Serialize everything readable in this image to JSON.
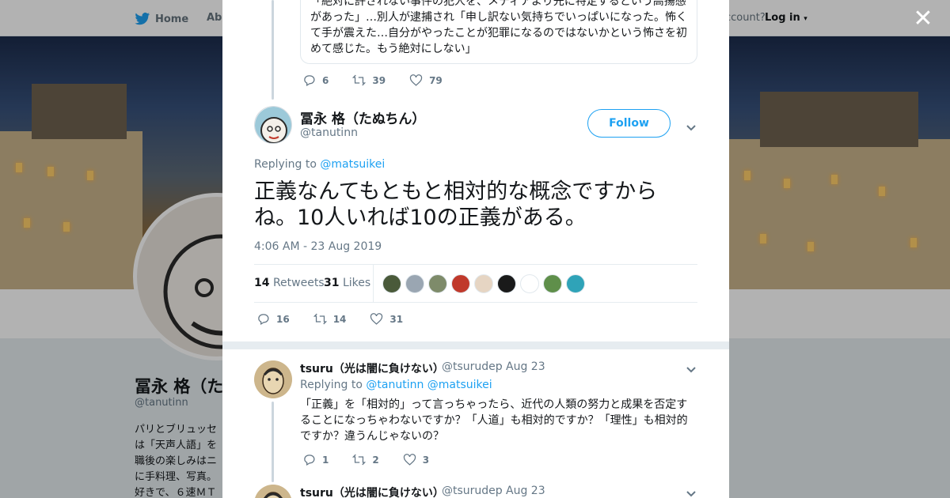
{
  "nav": {
    "home_label": "Home",
    "about_label": "Abo",
    "account_label": "ccount?",
    "login_label": "Log in"
  },
  "background_profile": {
    "name": "冨永 格（た",
    "handle": "@tanutinn",
    "bio": "パリとブリュッセ\nは「天声人語」を\n職後の楽しみはニ\nに手料理、写真。\n好きで、６速ＭＴ"
  },
  "quoted_tweet": {
    "text": "「絶対に許されない事件の犯人を、メディアより先に特定するという高揚感があった」…別人が逮捕され「申し訳ない気持ちでいっぱいになった。怖くて手が震えた…自分がやったことが犯罪になるのではないかという怖さを初めて感じた。もう絶対にしない」",
    "replies": "6",
    "retweets": "39",
    "likes": "79"
  },
  "main_tweet": {
    "name": "冨永 格（たぬちん）",
    "handle": "@tanutinn",
    "follow_label": "Follow",
    "replying_prefix": "Replying to",
    "replying_to": "@matsuikei",
    "text": "正義なんてもともと相対的な概念ですからね。10人いれば10の正義がある。",
    "timestamp": "4:06 AM - 23 Aug 2019",
    "retweets_count": "14",
    "retweets_label": "Retweets",
    "likes_count": "31",
    "likes_label": "Likes",
    "replies": "16",
    "retweets": "14",
    "likes": "31",
    "liker_colors": [
      "#4a5a3a",
      "#9aa6b2",
      "#7e8b6a",
      "#c0392b",
      "#e6d5c3",
      "#1a1a1a",
      "#ffffff",
      "#5f8f4a",
      "#2fa3b8"
    ]
  },
  "replies": [
    {
      "name": "tsuru（光は闇に負けない）",
      "handle": "@tsurudep",
      "date": "Aug 23",
      "replying_prefix": "Replying to",
      "replying_to": "@tanutinn @matsuikei",
      "text": "「正義」を「相対的」って言っちゃったら、近代の人類の努力と成果を否定することになっちゃわないですか？「人道」も相対的ですか？「理性」も相対的ですか？違うんじゃないの？",
      "replies": "1",
      "retweets": "2",
      "likes": "3"
    },
    {
      "name": "tsuru（光は闇に負けない）",
      "handle": "@tsurudep",
      "date": "Aug 23"
    }
  ],
  "colors": {
    "accent": "#1da1f2",
    "text": "#14171a",
    "muted": "#657786"
  },
  "icons": {
    "brand": "twitter-bird-icon",
    "close": "close-icon",
    "reply": "reply-icon",
    "retweet": "retweet-icon",
    "like": "heart-icon",
    "more": "chevron-down-icon"
  }
}
